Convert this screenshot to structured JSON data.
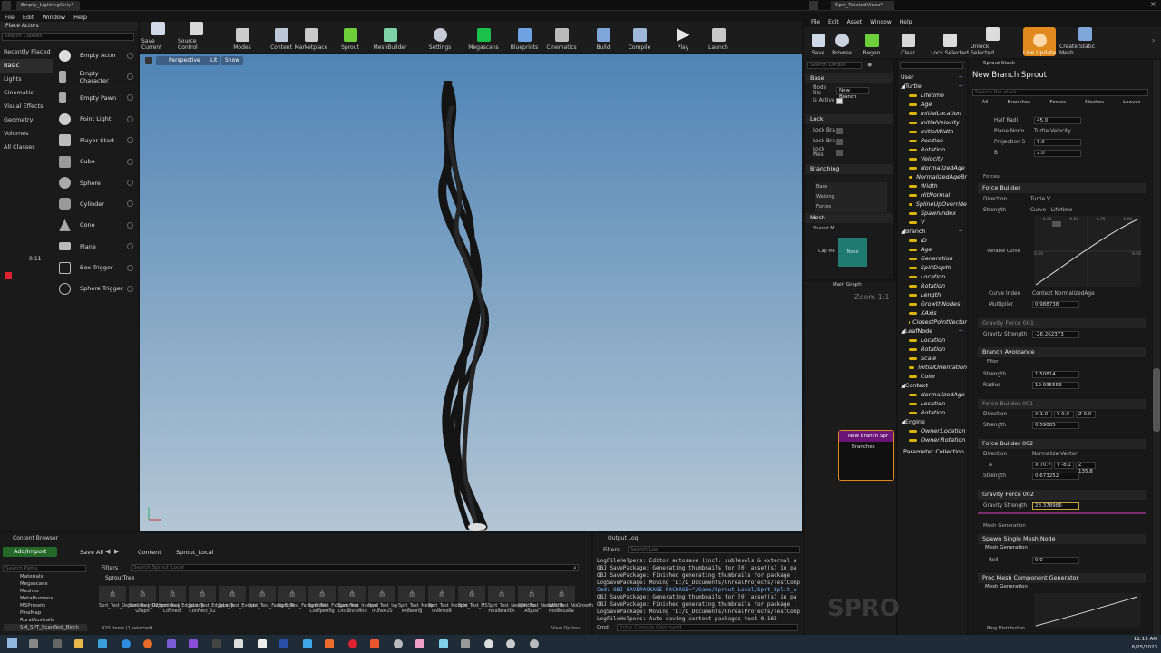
{
  "left_window": {
    "tab_title": "Empty_LightingOnly*",
    "menu": [
      "File",
      "Edit",
      "Window",
      "Help"
    ],
    "place_actors_title": "Place Actors",
    "search_placeholder": "Search Classes",
    "categories": [
      "Recently Placed",
      "Basic",
      "Lights",
      "Cinematic",
      "Visual Effects",
      "Geometry",
      "Volumes",
      "All Classes"
    ],
    "actors": [
      "Empty Actor",
      "Empty Character",
      "Empty Pawn",
      "Point Light",
      "Player Start",
      "Cube",
      "Sphere",
      "Cylinder",
      "Cone",
      "Plane",
      "Box Trigger",
      "Sphere Trigger"
    ],
    "toolbar": [
      "Save Current",
      "Source Control",
      "Modes",
      "Content",
      "Marketplace",
      "Sprout",
      "MeshBuilder",
      "Settings",
      "Megascans",
      "Blueprints",
      "Cinematics",
      "Build",
      "Compile",
      "Play",
      "Launch"
    ],
    "viewport": {
      "perspective": "Perspective",
      "lit": "Lit",
      "show": "Show"
    },
    "recording_time": "0:11"
  },
  "content_browser": {
    "tab": "Content Browser",
    "add_import": "Add/Import",
    "save_all": "Save All",
    "path": [
      "Content",
      "Sprout_Local"
    ],
    "search_paths": "Search Paths",
    "search_placeholder": "Search Sprout_Local",
    "filters": "Filters",
    "tree": [
      "Materials",
      "Megascans",
      "Meshes",
      "MetaHumans",
      "MSPresets",
      "PineMap",
      "RuralAustralia",
      "SM_SPT_ScanTest_Birch"
    ],
    "folder": "SproutTree",
    "assets": [
      "Sprt_Test_Dependency_02",
      "Sprt_Test_Dependency Graph",
      "Sprt_Test_EdgeLoop Connect",
      "Sprt_Test_EdgeLoop Connect_02",
      "Sprt_Test_Events",
      "Sprt_Test_FancySplit",
      "Sprt_Test_FancyWeld",
      "Sprt_Test_FxSpawners Competing",
      "Sprt_Test_Interval DistanceAnd",
      "Sprt_Test_Ivy Trunk010",
      "Sprt_Test_Mesh Modeling",
      "Sprt_Test_Module Override",
      "Sprt_Test_MS",
      "Sprt_Test_NewDistNo FinalBranch",
      "Sprt_Test_NewWidth Adjust",
      "Sprt_Test_NoGrowth NodesSave"
    ],
    "status": "420 items (1 selected)",
    "view_options": "View Options"
  },
  "output_log": {
    "tab": "Output Log",
    "filters": "Filters",
    "search_placeholder": "Search Log",
    "lines": [
      "LogFileHelpers: Editor autosave (incl. sublevels & external a",
      "OBJ SavePackage: Generating thumbnails for [0] asset(s) in pa",
      "OBJ SavePackage: Finished generating thumbnails for package [",
      "LogSavePackage: Moving 'D:/D_Documents/UnrealProjects/TestComp",
      "Cmd: OBJ SAVEPACKAGE PACKAGE=\"/Game/Sprout_Local/Sprt_Split_A",
      "OBJ SavePackage: Generating thumbnails for [0] asset(s) in pa",
      "OBJ SavePackage: Finished generating thumbnails for package [",
      "LogSavePackage: Moving 'D:/D_Documents/UnrealProjects/TestComp",
      "LogFileHelpers: Auto-saving content packages took 0.165"
    ],
    "cmd_label": "Cmd",
    "cmd_placeholder": "Enter Console Command"
  },
  "right_window": {
    "tab_title": "Sprt_TwistedVines*",
    "menu": [
      "File",
      "Edit",
      "Asset",
      "Window",
      "Help"
    ],
    "toolbar": [
      "Save",
      "Browse",
      "Regen",
      "Clear",
      "Lock Selected",
      "Unlock Selected",
      "Live Update",
      "Create Static Mesh"
    ],
    "details_search": "Search Details",
    "details_sections": [
      "Base",
      "Lock",
      "Branching",
      "Mesh"
    ],
    "details_rows": [
      "Node Dis",
      "New Branch",
      "Is Active",
      "Lock Bra",
      "Lock Bra",
      "Lock Mes",
      "Base",
      "Walking",
      "Forces",
      "Shared M",
      "Cap Me",
      "None"
    ],
    "user_label": "User",
    "variables": {
      "Turtle": [
        "Lifetime",
        "Age",
        "InitialLocation",
        "InitialVelocity",
        "InitialWidth",
        "Position",
        "Rotation",
        "Velocity",
        "NormalizedAge",
        "NormalizedAgeBr",
        "Width",
        "HitNormal",
        "SplineUpOverride",
        "SpawnIndex",
        "V"
      ],
      "Branch": [
        "ID",
        "Age",
        "Generation",
        "SplitDepth",
        "Location",
        "Rotation",
        "Length",
        "GrowthNodes",
        "XAxis",
        "ClosestPointVector"
      ],
      "LeafNode": [
        "Location",
        "Rotation",
        "Scale",
        "InitialOrientation",
        "Color"
      ],
      "Context": [
        "NormalizedAge",
        "Location",
        "Rotation"
      ],
      "Engine": [
        "Owner.Location",
        "Owner.Rotation"
      ]
    },
    "parameter_collection": "Parameter Collection",
    "graph_tab": "Main Graph",
    "zoom": "Zoom 1:1",
    "graph_node_title": "New Branch Spr",
    "graph_node_pin": "Branches",
    "watermark": "SPRO",
    "stack_tab": "Sprout Stack",
    "stack_title": "New Branch Sprout",
    "stack_search": "Search the stack",
    "stack_tabs": [
      "All",
      "Branches",
      "Forces",
      "Meshes",
      "Leaves"
    ],
    "stack_rows": [
      {
        "label": "Half Radi",
        "value": "45.0"
      },
      {
        "label": "Plane Norm",
        "value": "Turtle Velocity"
      },
      {
        "label": "Projection S",
        "value": "1.0"
      },
      {
        "label": "B",
        "value": "2.0"
      }
    ],
    "forces_label": "Forces",
    "force_builder": "Force Builder",
    "fb_direction": "Direction",
    "fb_direction_val": "Turtle V",
    "fb_strength": "Strength",
    "fb_strength_val": "Curve - Lifetime",
    "curve_ticks": [
      "0.25",
      "0.50",
      "0.75",
      "1.00",
      "0.50",
      "0.50"
    ],
    "variable_curve": "Variable Curve",
    "curve_index": "Curve Index",
    "curve_index_val": "Context NormalizedAge",
    "multiplier": "Multiplier",
    "multiplier_val": "0.988738",
    "gravity_001": "Gravity Force 001",
    "gravity_strength": "Gravity Strength",
    "gravity_001_val": "-26.262373",
    "branch_avoidance": "Branch Avoidance",
    "filter": "Filter",
    "ba_strength": "Strength",
    "ba_strength_val": "1.50814",
    "ba_radius": "Radius",
    "ba_radius_val": "19.935553",
    "fb_001": "Force Builder 001",
    "fb_001_dir": [
      "X 1.0",
      "Y 0.0",
      "Z 0.0"
    ],
    "fb_001_strength": "0.59085",
    "fb_002": "Force Builder 002",
    "fb_002_dir_val": "Normalize Vector",
    "fb_002_a": "A",
    "fb_002_vec": [
      "X 70.7",
      "Y -8.1",
      "Z 135.8"
    ],
    "fb_002_strength": "0.673252",
    "gravity_002": "Gravity Force 002",
    "gravity_002_val": "28.378986",
    "mesh_generation": "Mesh Generation",
    "spawn_single": "Spawn Single Mesh Node",
    "mesh_gen2": "Mesh Generation",
    "roll": "Roll",
    "roll_val": "0.0",
    "proc_mesh": "Proc Mesh Component Generator",
    "mesh_gen3": "Mesh Generation",
    "ring_distribution": "Ring Distribution"
  },
  "taskbar": {
    "time": "11:13 AM",
    "date": "6/25/2023"
  }
}
